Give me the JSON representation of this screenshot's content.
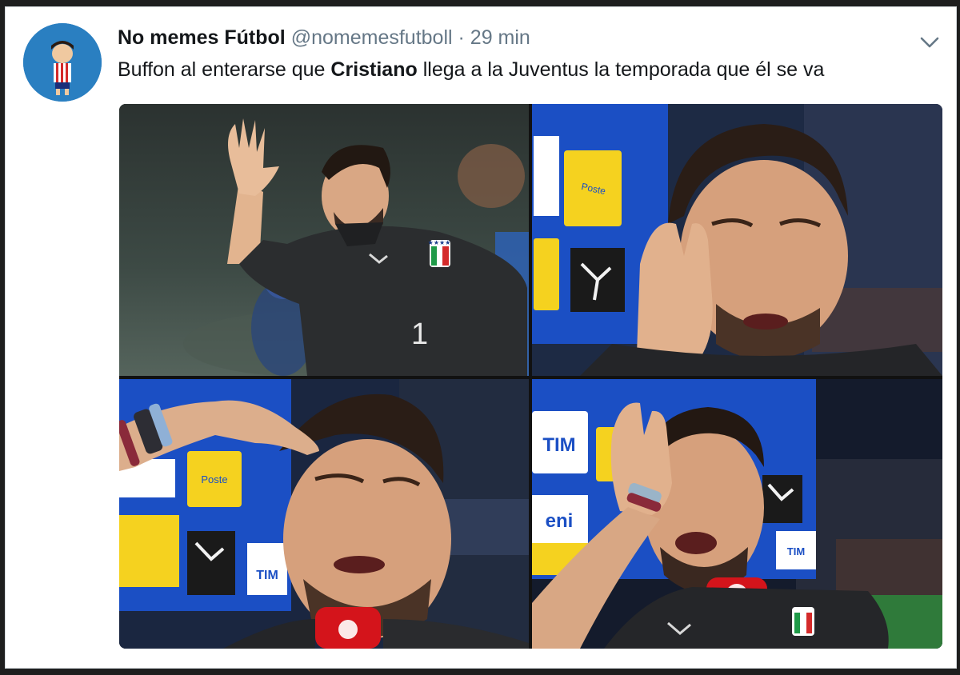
{
  "tweet": {
    "display_name": "No memes Fútbol",
    "handle": "@nomemesfutboll",
    "separator": "·",
    "time": "29 min",
    "text_before": "Buffon al enterarse que ",
    "text_bold": "Cristiano",
    "text_after": " llega a la Juventus la temporada que él se va"
  },
  "media": {
    "photo_count": 4,
    "sponsor_labels": {
      "poste": "Poste italiane",
      "tim": "TIM",
      "eni": "eni",
      "jersey_number": "1"
    }
  },
  "colors": {
    "text": "#14171a",
    "secondary_text": "#657786",
    "avatar_bg": "#2a7fc1",
    "board_blue": "#1b4fc4",
    "poste_yellow": "#f5d21f",
    "mic_red": "#d4141b"
  },
  "icons": {
    "avatar": "avatar-icon",
    "menu": "chevron-down-icon"
  }
}
